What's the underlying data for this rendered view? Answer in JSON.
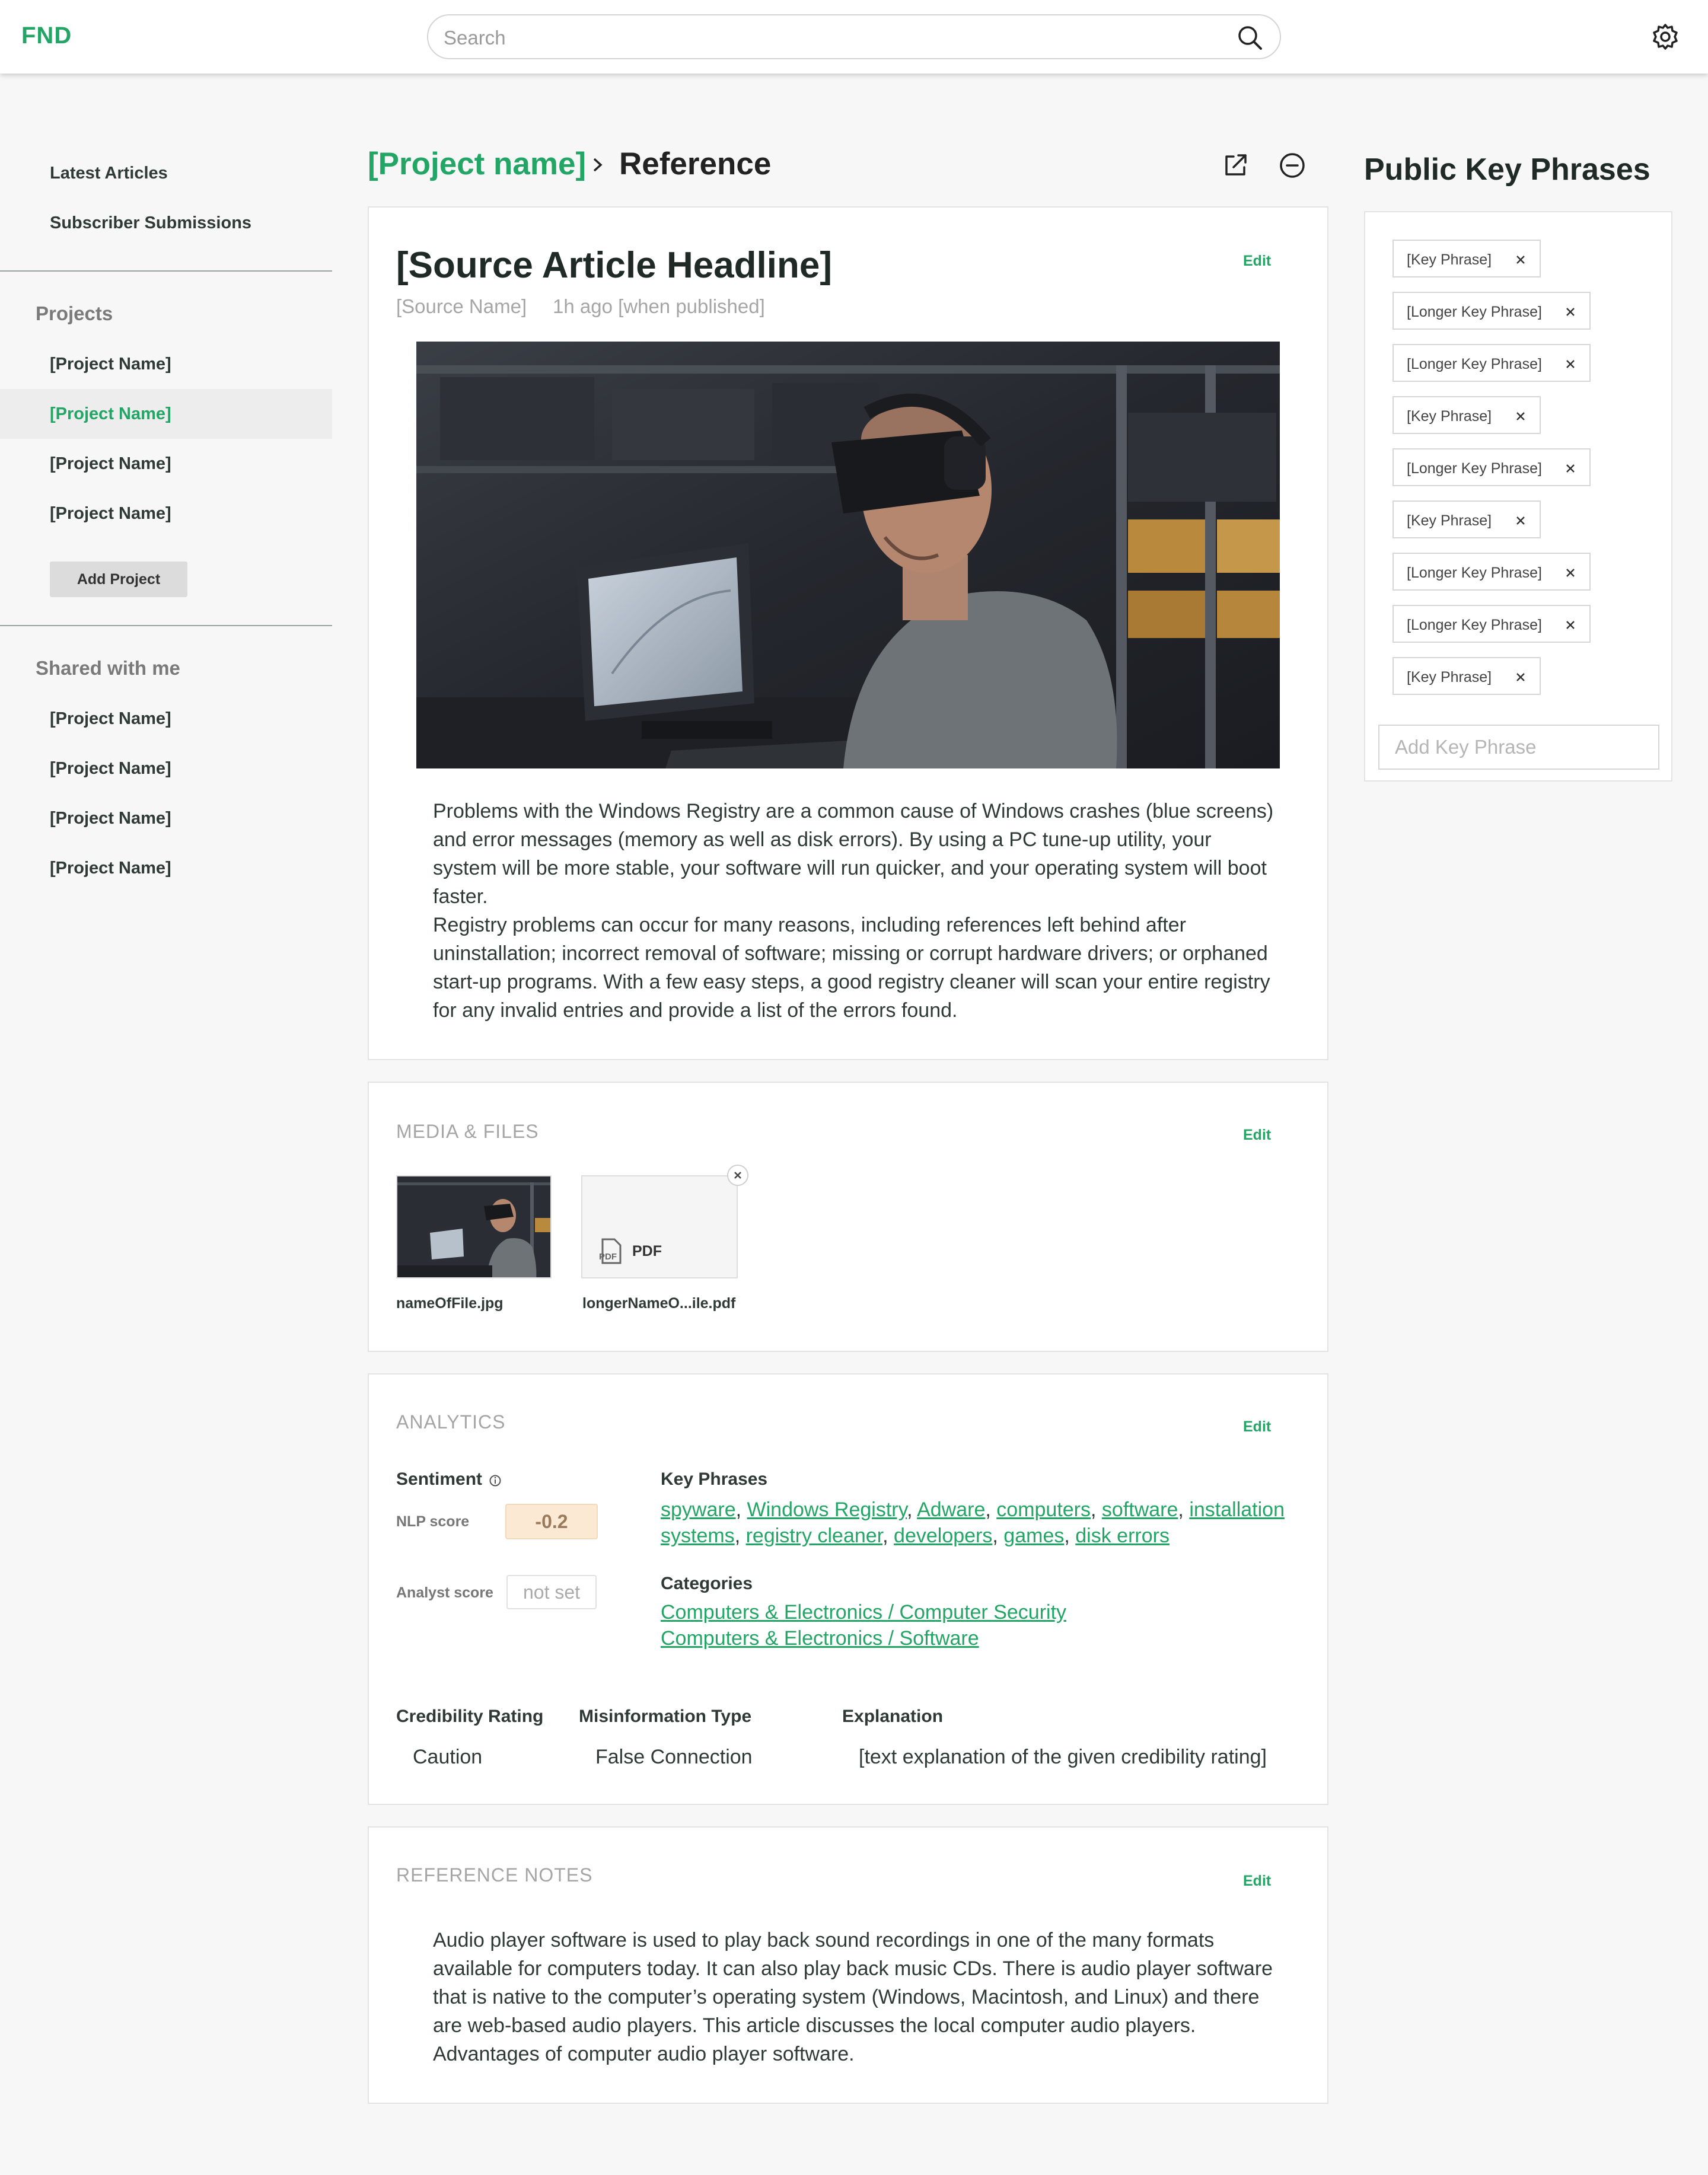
{
  "header": {
    "logo": "FND",
    "search_placeholder": "Search"
  },
  "sidebar": {
    "links": [
      "Latest Articles",
      "Subscriber Submissions"
    ],
    "projects_heading": "Projects",
    "projects": [
      "[Project Name]",
      "[Project Name]",
      "[Project Name]",
      "[Project Name]"
    ],
    "active_project_index": 1,
    "add_project_label": "Add Project",
    "shared_heading": "Shared with me",
    "shared": [
      "[Project Name]",
      "[Project Name]",
      "[Project Name]",
      "[Project Name]"
    ]
  },
  "breadcrumb": {
    "project": "[Project name]",
    "current": "Reference"
  },
  "article": {
    "headline": "[Source Article Headline]",
    "source_name": "[Source Name]",
    "published": "1h ago [when published]",
    "edit_label": "Edit",
    "paragraphs": [
      "Problems with the Windows Registry are a common cause of Windows crashes (blue screens) and error messages (memory as well as disk errors). By using a PC tune-up utility, your system will be more stable, your software will run quicker, and your operating system will boot faster.",
      "Registry problems can occur for many reasons, including references left behind after uninstallation; incorrect removal of software; missing or corrupt hardware drivers; or orphaned start-up programs. With a few easy steps, a good registry cleaner will scan your entire registry for any invalid entries and provide a list of the errors found."
    ]
  },
  "media": {
    "title": "MEDIA & FILES",
    "edit_label": "Edit",
    "files": [
      {
        "name": "nameOfFile.jpg",
        "type": "image"
      },
      {
        "name": "longerNameO...ile.pdf",
        "type": "PDF"
      }
    ]
  },
  "analytics": {
    "title": "ANALYTICS",
    "edit_label": "Edit",
    "sentiment_label": "Sentiment",
    "nlp_label": "NLP score",
    "nlp_score": "-0.2",
    "analyst_label": "Analyst score",
    "analyst_score": "not set",
    "key_phrases_label": "Key Phrases",
    "key_phrases": [
      "spyware",
      "Windows Registry",
      "Adware",
      "computers",
      "software",
      "installation systems",
      "registry cleaner",
      "developers",
      "games",
      "disk errors"
    ],
    "categories_label": "Categories",
    "categories": [
      "Computers & Electronics / Computer Security",
      "Computers & Electronics / Software"
    ],
    "credibility_label": "Credibility Rating",
    "credibility_value": "Caution",
    "misinfo_label": "Misinformation Type",
    "misinfo_value": "False Connection",
    "explanation_label": "Explanation",
    "explanation_value": "[text explanation of the given credibility rating]"
  },
  "notes": {
    "title": "REFERENCE NOTES",
    "edit_label": "Edit",
    "text": "Audio player software is used to play back sound recordings in one of the many formats available for computers today. It can also play back music CDs. There is audio player software that is native to the computer’s operating system (Windows, Macintosh, and Linux) and there are web-based audio players. This article discusses the local computer audio players. Advantages of computer audio player software."
  },
  "key_phrases_panel": {
    "title": "Public Key Phrases",
    "chips": [
      "[Key Phrase]",
      "[Longer Key Phrase]",
      "[Longer Key Phrase]",
      "[Key Phrase]",
      "[Longer Key Phrase]",
      "[Key Phrase]",
      "[Longer Key Phrase]",
      "[Longer Key Phrase]",
      "[Key Phrase]"
    ],
    "add_placeholder": "Add Key Phrase"
  },
  "colors": {
    "accent": "#22a565",
    "nlp_badge": "#fbe9d3"
  },
  "icons": [
    "search-icon",
    "gear-icon",
    "chevron-right-icon",
    "external-link-icon",
    "minus-circle-icon",
    "info-icon",
    "pdf-icon",
    "close-icon"
  ]
}
